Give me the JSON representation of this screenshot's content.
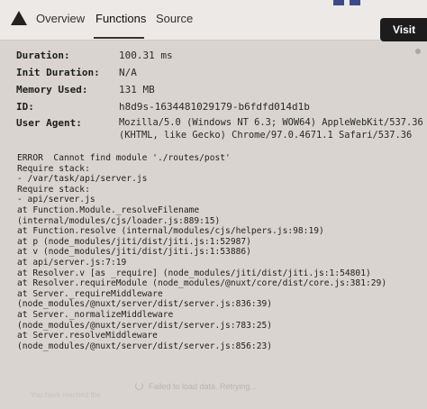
{
  "nav": {
    "tabs": [
      {
        "label": "Overview"
      },
      {
        "label": "Functions"
      },
      {
        "label": "Source"
      }
    ],
    "visit_label": "Visit"
  },
  "meta": [
    {
      "label": "Duration:",
      "value": "100.31 ms"
    },
    {
      "label": "Init Duration:",
      "value": "N/A"
    },
    {
      "label": "Memory Used:",
      "value": "131 MB"
    },
    {
      "label": "ID:",
      "value": "h8d9s-1634481029179-b6fdfd014d1b"
    },
    {
      "label": "User Agent:",
      "value": "Mozilla/5.0 (Windows NT 6.3; WOW64) AppleWebKit/537.36",
      "value2": "(KHTML, like Gecko) Chrome/97.0.4671.1 Safari/537.36"
    }
  ],
  "log_lines": [
    "ERROR  Cannot find module './routes/post'",
    "Require stack:",
    "- /var/task/api/server.js",
    "Require stack:",
    "- api/server.js",
    "at Function.Module._resolveFilename",
    "(internal/modules/cjs/loader.js:889:15)",
    "at Function.resolve (internal/modules/cjs/helpers.js:98:19)",
    "at p (node_modules/jiti/dist/jiti.js:1:52987)",
    "at v (node_modules/jiti/dist/jiti.js:1:53886)",
    "at api/server.js:7:19",
    "at Resolver.v [as _require] (node_modules/jiti/dist/jiti.js:1:54801)",
    "at Resolver.requireModule (node_modules/@nuxt/core/dist/core.js:381:29)",
    "at Server._requireMiddleware",
    "(node_modules/@nuxt/server/dist/server.js:836:39)",
    "at Server._normalizeMiddleware",
    "(node_modules/@nuxt/server/dist/server.js:783:25)",
    "at Server.resolveMiddleware",
    "(node_modules/@nuxt/server/dist/server.js:856:23)"
  ],
  "footer": {
    "status": "Failed to load data. Retrying...",
    "left_note": "You have reached the"
  },
  "colors": {
    "accent": "#1c1c1c",
    "background": "#d9d4cf"
  }
}
